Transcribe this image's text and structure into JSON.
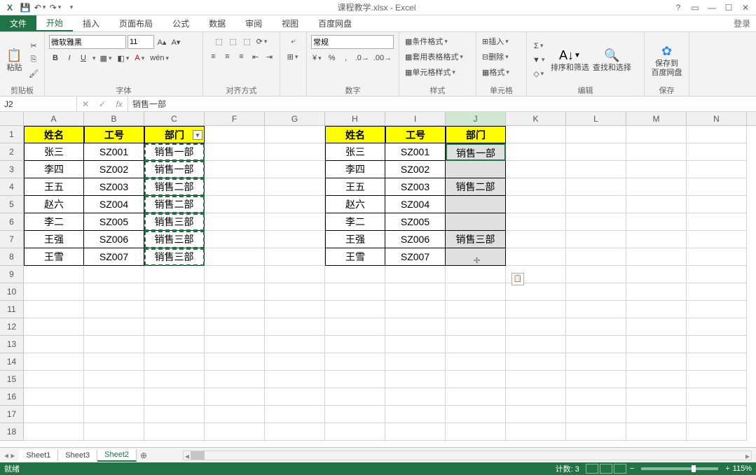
{
  "titlebar": {
    "title": "课程教学.xlsx - Excel"
  },
  "tabs": {
    "file": "文件",
    "home": "开始",
    "insert": "插入",
    "layout": "页面布局",
    "formulas": "公式",
    "data": "数据",
    "review": "审阅",
    "view": "视图",
    "baidu": "百度网盘",
    "login": "登录"
  },
  "ribbon": {
    "clipboard": {
      "label": "剪贴板",
      "paste": "粘贴"
    },
    "font": {
      "label": "字体",
      "name": "微软雅黑",
      "size": "11",
      "bold": "B",
      "italic": "I",
      "underline": "U"
    },
    "align": {
      "label": "对齐方式"
    },
    "number": {
      "label": "数字",
      "format": "常规"
    },
    "styles": {
      "label": "样式",
      "cond": "条件格式",
      "table": "套用表格格式",
      "cell": "单元格样式"
    },
    "cells": {
      "label": "单元格",
      "insert": "插入",
      "delete": "删除",
      "format": "格式"
    },
    "editing": {
      "label": "编辑",
      "sort": "排序和筛选",
      "find": "查找和选择"
    },
    "save": {
      "label": "保存",
      "btn": "保存到\n百度网盘"
    }
  },
  "formula": {
    "namebox": "J2",
    "value": "销售一部"
  },
  "columns": [
    "A",
    "B",
    "C",
    "F",
    "G",
    "H",
    "I",
    "J",
    "K",
    "L",
    "M",
    "N"
  ],
  "col_sel": "J",
  "row_headers": [
    1,
    2,
    3,
    4,
    5,
    6,
    7,
    8,
    9,
    10,
    11,
    12,
    13,
    14,
    15,
    16,
    17,
    18
  ],
  "tableA": {
    "headers": [
      "姓名",
      "工号",
      "部门"
    ],
    "rows": [
      [
        "张三",
        "SZ001",
        "销售一部"
      ],
      [
        "李四",
        "SZ002",
        "销售一部"
      ],
      [
        "王五",
        "SZ003",
        "销售二部"
      ],
      [
        "赵六",
        "SZ004",
        "销售二部"
      ],
      [
        "李二",
        "SZ005",
        "销售三部"
      ],
      [
        "王强",
        "SZ006",
        "销售三部"
      ],
      [
        "王雪",
        "SZ007",
        "销售三部"
      ]
    ]
  },
  "tableB": {
    "headers": [
      "姓名",
      "工号",
      "部门"
    ],
    "rows": [
      [
        "张三",
        "SZ001",
        "销售一部"
      ],
      [
        "李四",
        "SZ002",
        ""
      ],
      [
        "王五",
        "SZ003",
        "销售二部"
      ],
      [
        "赵六",
        "SZ004",
        ""
      ],
      [
        "李二",
        "SZ005",
        ""
      ],
      [
        "王强",
        "SZ006",
        "销售三部"
      ],
      [
        "王雪",
        "SZ007",
        ""
      ]
    ]
  },
  "sheets": {
    "s1": "Sheet1",
    "s3": "Sheet3",
    "s2": "Sheet2"
  },
  "status": {
    "ready": "就绪",
    "count": "计数: 3",
    "zoom": "115%",
    "minus": "−",
    "plus": "+"
  }
}
